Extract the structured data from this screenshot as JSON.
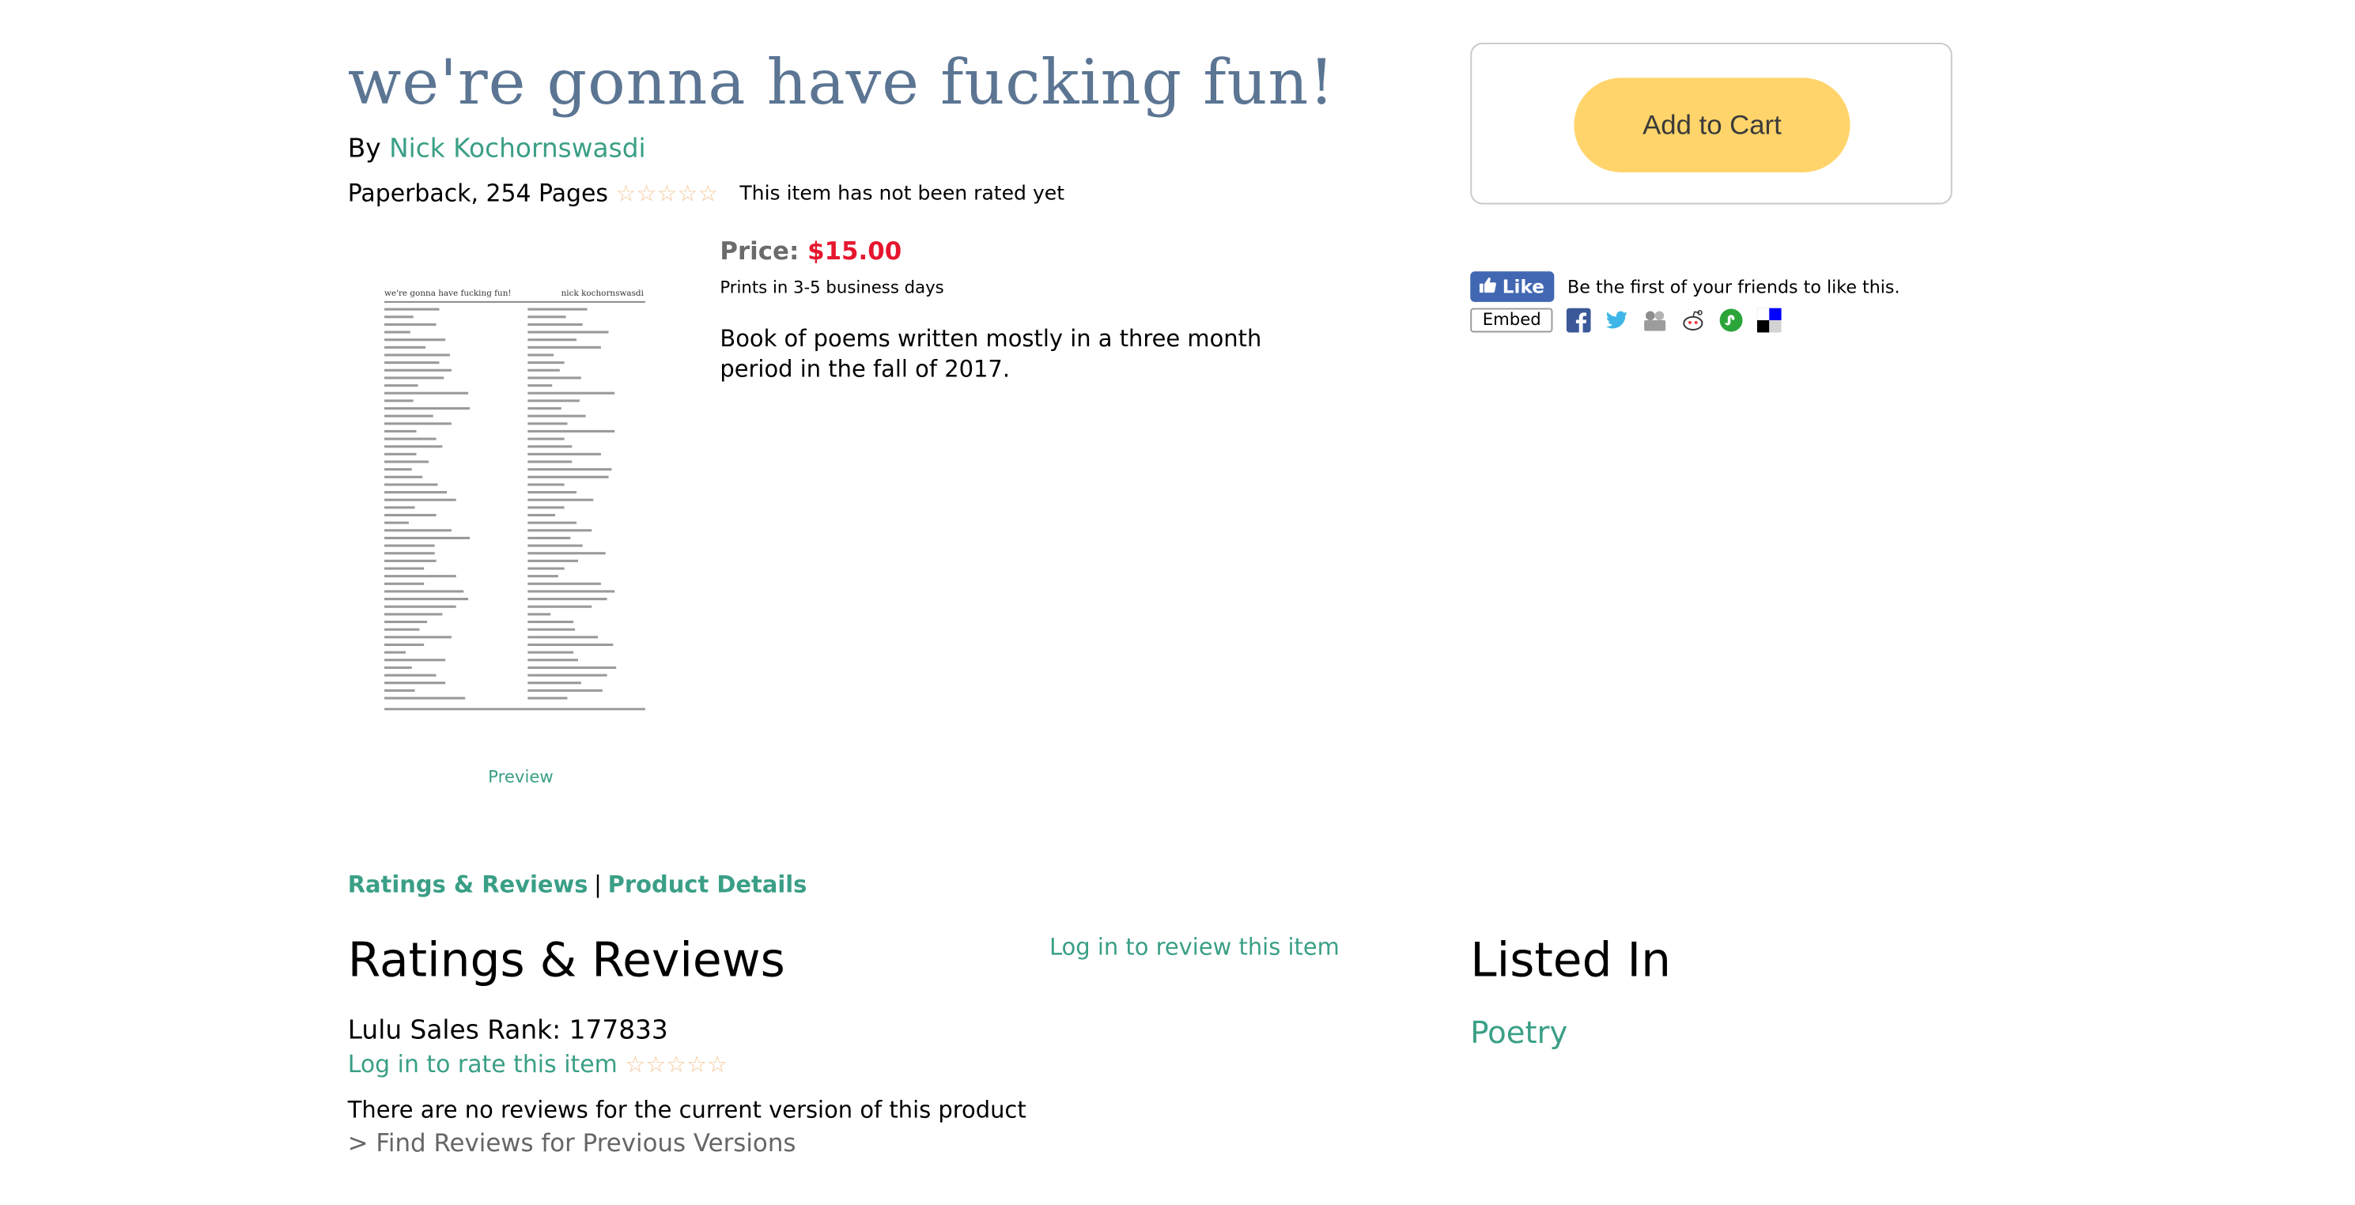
{
  "product": {
    "title": "we're gonna have fucking fun!",
    "by_label": "By",
    "author": "Nick Kochornswasdi",
    "format": "Paperback, 254 Pages",
    "rating_status": "This item has not been rated yet",
    "stars_total": 5,
    "stars_filled": 0,
    "preview_label": "Preview",
    "price_label": "Price:",
    "price": "$15.00",
    "prints_in": "Prints in 3-5 business days",
    "description": "Book of poems written mostly in a three month period in the fall of 2017.",
    "cover": {
      "header_left": "we're gonna have fucking fun!",
      "header_right": "nick kochornswasdi"
    }
  },
  "cart": {
    "add_label": "Add to Cart"
  },
  "social": {
    "like_label": "Like",
    "like_text": "Be the first of your friends to like this.",
    "embed_label": "Embed",
    "icons": [
      "facebook-icon",
      "twitter-icon",
      "digg-icon",
      "reddit-icon",
      "stumbleupon-icon",
      "delicious-icon"
    ]
  },
  "tabs": {
    "ratings": "Ratings & Reviews",
    "separator": "|",
    "details": "Product Details"
  },
  "reviews": {
    "heading": "Ratings & Reviews",
    "login_review": "Log in to review this item",
    "sales_rank": "Lulu Sales Rank: 177833",
    "login_rate": "Log in to rate this item",
    "no_reviews": "There are no reviews for the current version of this product",
    "previous_versions": "> Find Reviews for Previous Versions"
  },
  "listed": {
    "heading": "Listed In",
    "category": "Poetry"
  },
  "colors": {
    "link": "#3a9f86",
    "title": "#5b7593",
    "price": "#e6162e",
    "cart_button": "#ffd46a",
    "star_outline": "#f6c89c",
    "facebook": "#4267b2"
  }
}
